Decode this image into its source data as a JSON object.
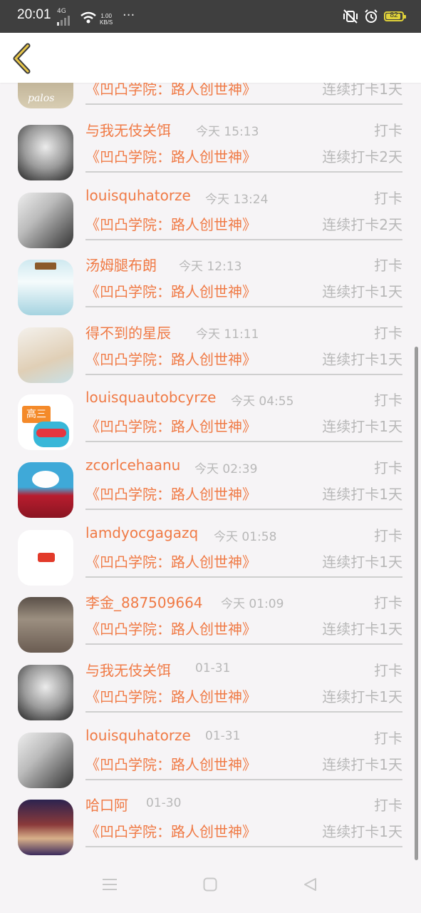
{
  "status_bar": {
    "time": "20:01",
    "network": "4G",
    "speed_value": "1.00",
    "speed_unit": "KB/S",
    "more": "···",
    "battery": "82"
  },
  "colors": {
    "accent": "#f07a45",
    "muted": "#b8b8b8",
    "battery": "#e0d23a"
  },
  "records": [
    {
      "name": "",
      "time": "",
      "action": "",
      "course": "《凹凸学院：路人创世神》",
      "streak": "连续打卡1天"
    },
    {
      "name": "与我无伎关饵",
      "time": "今天 15:13",
      "action": "打卡",
      "course": "《凹凸学院：路人创世神》",
      "streak": "连续打卡2天"
    },
    {
      "name": "louisquhatorze",
      "time": "今天 13:24",
      "action": "打卡",
      "course": "《凹凸学院：路人创世神》",
      "streak": "连续打卡2天"
    },
    {
      "name": "汤姆腿布朗",
      "time": "今天 12:13",
      "action": "打卡",
      "course": "《凹凸学院：路人创世神》",
      "streak": "连续打卡1天"
    },
    {
      "name": "得不到的星辰",
      "time": "今天 11:11",
      "action": "打卡",
      "course": "《凹凸学院：路人创世神》",
      "streak": "连续打卡1天"
    },
    {
      "name": "louisquautobcyrze",
      "time": "今天 04:55",
      "action": "打卡",
      "course": "《凹凸学院：路人创世神》",
      "streak": "连续打卡1天"
    },
    {
      "name": "zcorlcehaanu",
      "time": "今天 02:39",
      "action": "打卡",
      "course": "《凹凸学院：路人创世神》",
      "streak": "连续打卡1天"
    },
    {
      "name": "lamdyocgagazq",
      "time": "今天 01:58",
      "action": "打卡",
      "course": "《凹凸学院：路人创世神》",
      "streak": "连续打卡1天"
    },
    {
      "name": "李金_887509664",
      "time": "今天 01:09",
      "action": "打卡",
      "course": "《凹凸学院：路人创世神》",
      "streak": "连续打卡1天"
    },
    {
      "name": "与我无伎关饵",
      "time": "01-31",
      "action": "打卡",
      "course": "《凹凸学院：路人创世神》",
      "streak": "连续打卡1天"
    },
    {
      "name": "louisquhatorze",
      "time": "01-31",
      "action": "打卡",
      "course": "《凹凸学院：路人创世神》",
      "streak": "连续打卡1天"
    },
    {
      "name": "哈口阿",
      "time": "01-30",
      "action": "打卡",
      "course": "《凹凸学院：路人创世神》",
      "streak": "连续打卡1天"
    }
  ],
  "avatar_badge_text": "高三",
  "avatar_caption": "palos"
}
